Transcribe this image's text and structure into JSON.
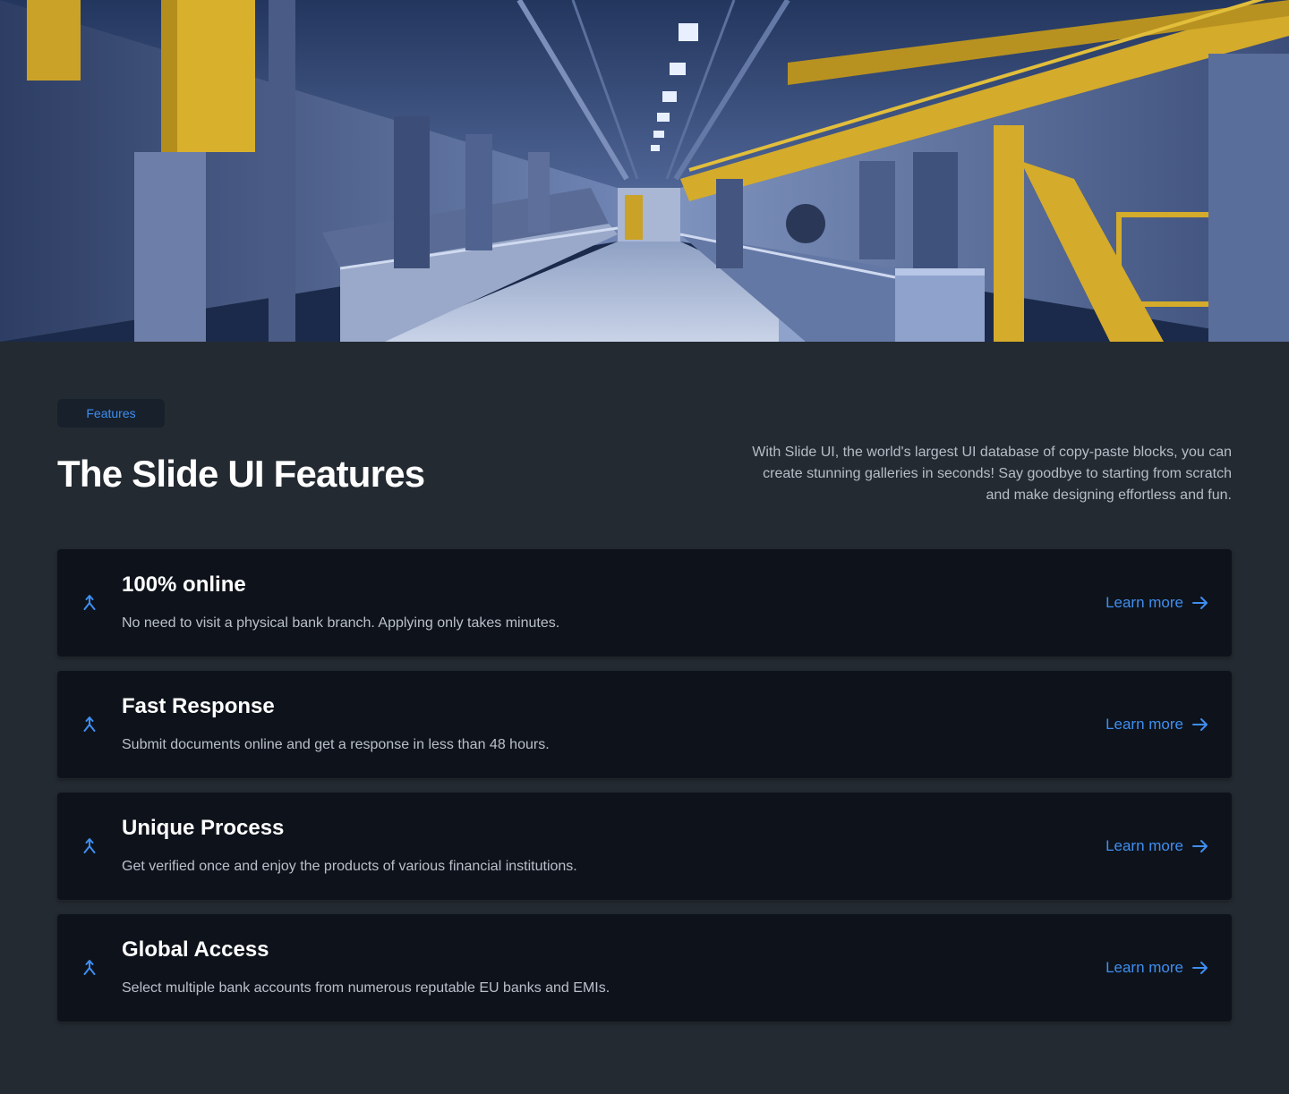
{
  "hero": {
    "image_alt": "factory-interior"
  },
  "section": {
    "badge_label": "Features",
    "title": "The Slide UI Features",
    "intro": "With Slide UI, the world's largest UI database of copy-paste blocks, you can create stunning galleries in seconds! Say goodbye to starting from scratch and make designing effortless and fun."
  },
  "features": [
    {
      "icon": "merge-arrow-icon",
      "title": "100% online",
      "description": "No need to visit a physical bank branch. Applying only takes minutes.",
      "link_label": "Learn more"
    },
    {
      "icon": "merge-arrow-icon",
      "title": "Fast Response",
      "description": "Submit documents online and get a response in less than 48 hours.",
      "link_label": "Learn more"
    },
    {
      "icon": "merge-arrow-icon",
      "title": "Unique Process",
      "description": "Get verified once and enjoy the products of various financial institutions.",
      "link_label": "Learn more"
    },
    {
      "icon": "merge-arrow-icon",
      "title": "Global Access",
      "description": "Select multiple bank accounts from numerous reputable EU banks and EMIs.",
      "link_label": "Learn more"
    }
  ],
  "colors": {
    "background": "#232a31",
    "card": "#0e131b",
    "accent": "#3f8ef0",
    "heading": "#ffffff",
    "body_text": "#b9c0c9"
  }
}
